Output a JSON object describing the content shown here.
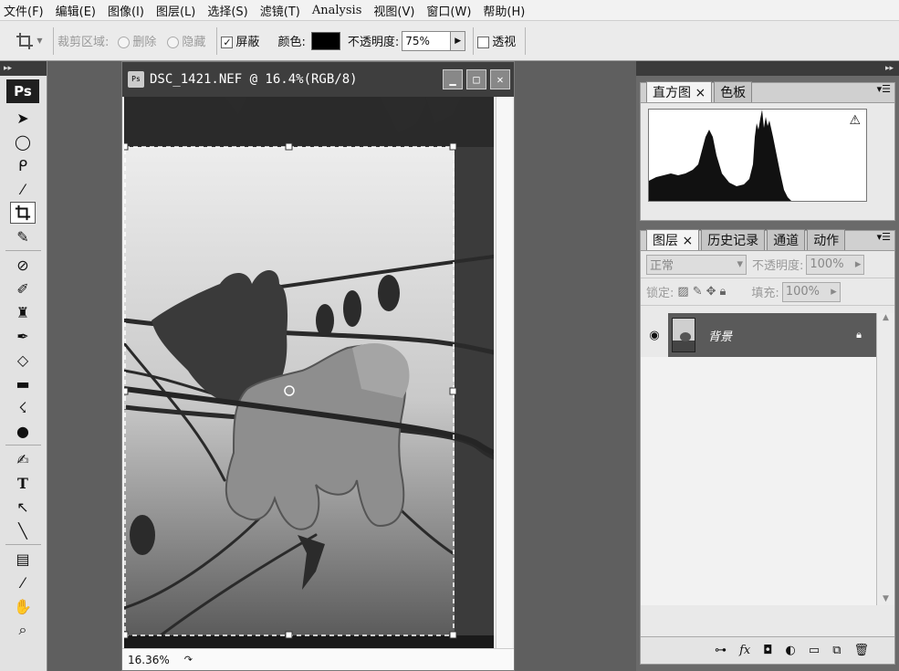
{
  "menu": [
    "文件(F)",
    "编辑(E)",
    "图像(I)",
    "图层(L)",
    "选择(S)",
    "滤镜(T)",
    "Analysis",
    "视图(V)",
    "窗口(W)",
    "帮助(H)"
  ],
  "options": {
    "crop_area_label": "裁剪区域:",
    "delete_label": "删除",
    "hide_label": "隐藏",
    "shield_label": "屏蔽",
    "color_label": "颜色:",
    "opacity_label": "不透明度:",
    "opacity_value": "75%",
    "perspective_label": "透视",
    "shield_checked": true,
    "perspective_checked": false,
    "shield_color": "#000000"
  },
  "toolbox": {
    "logo": "Ps",
    "tools": [
      "move-icon",
      "marquee-ellipse-icon",
      "lasso-icon",
      "magic-wand-icon",
      "crop-icon",
      "eyedropper-icon",
      "healing-brush-icon",
      "brush-icon",
      "clone-stamp-icon",
      "history-brush-icon",
      "eraser-icon",
      "gradient-icon",
      "blur-icon",
      "dodge-icon",
      "pen-icon",
      "type-icon",
      "path-select-icon",
      "line-icon",
      "notes-icon",
      "eyedropper-2-icon",
      "hand-icon",
      "zoom-icon"
    ],
    "selected_tool": "crop-icon"
  },
  "document": {
    "title": "DSC_1421.NEF @ 16.4%(RGB/8)",
    "zoom": "16.36%"
  },
  "histogram_panel": {
    "tabs": [
      "直方图",
      "色板"
    ],
    "active_tab": "直方图"
  },
  "layers_panel": {
    "tabs": [
      "图层",
      "历史记录",
      "通道",
      "动作"
    ],
    "active_tab": "图层",
    "blend_mode": "正常",
    "opacity_label": "不透明度:",
    "opacity_value": "100%",
    "lock_label": "锁定:",
    "fill_label": "填充:",
    "fill_value": "100%",
    "layer_name": "背景"
  }
}
